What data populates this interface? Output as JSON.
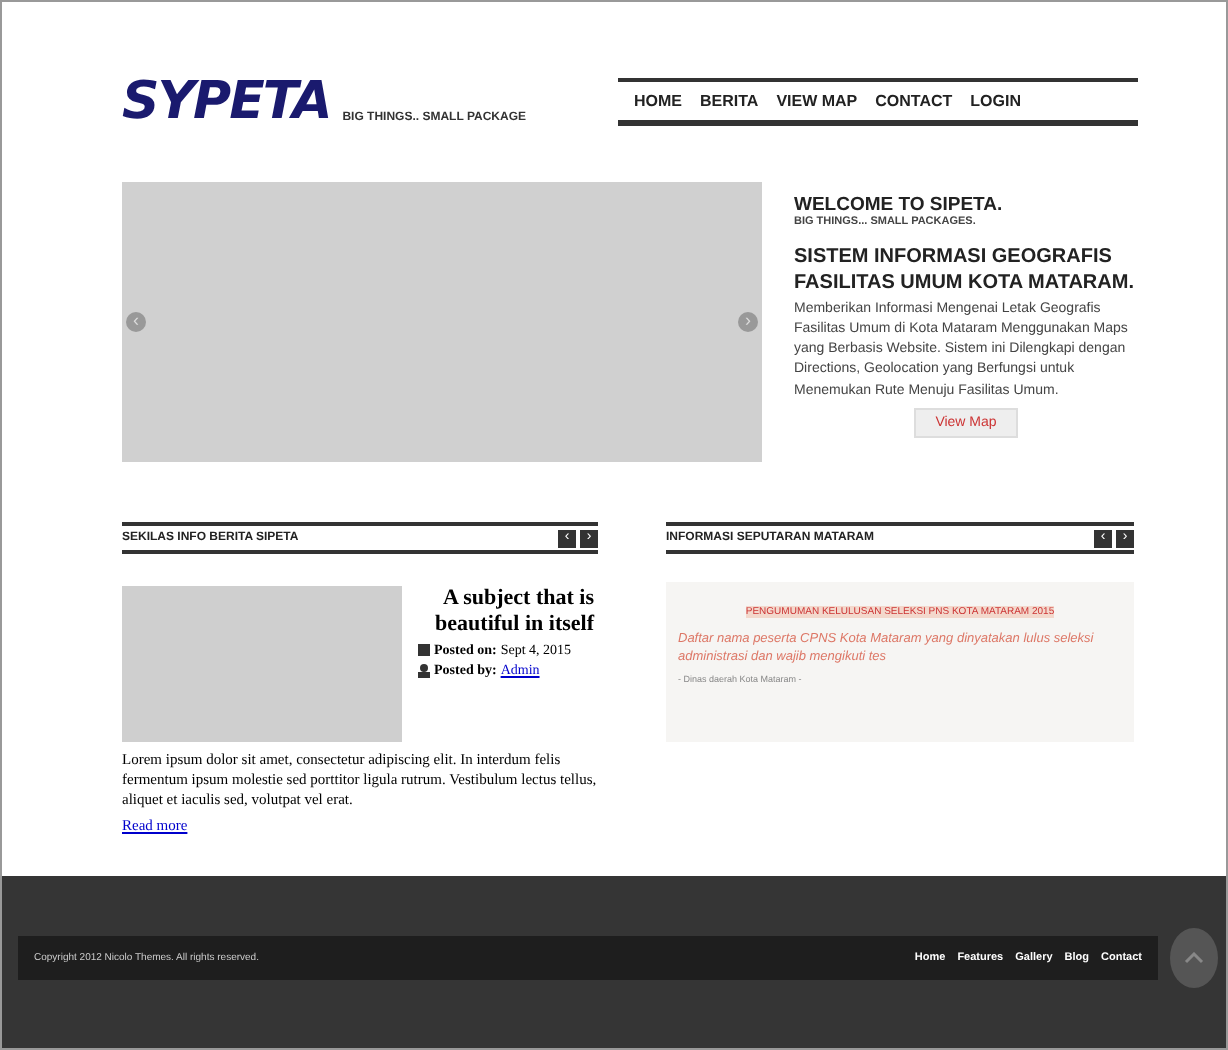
{
  "header": {
    "logo": "SYPETA",
    "tagline": "BIG THINGS.. SMALL PACKAGE"
  },
  "nav": [
    {
      "label": "HOME"
    },
    {
      "label": "BERITA"
    },
    {
      "label": "VIEW MAP"
    },
    {
      "label": "CONTACT"
    },
    {
      "label": "LOGIN"
    }
  ],
  "slider": {
    "prev": "‹",
    "next": "›"
  },
  "welcome": {
    "title": "WELCOME TO SIPETA.",
    "subtitle": "BIG THINGS... SMALL PACKAGES.",
    "heading": "SISTEM INFORMASI GEOGRAFIS FASILITAS UMUM KOTA MATARAM.",
    "description": "Memberikan Informasi Mengenai Letak Geografis Fasilitas Umum di Kota Mataram Menggunakan Maps yang Berbasis Website. Sistem ini Dilengkapi dengan Directions, Geolocation yang Berfungsi untuk Menemukan Rute Menuju Fasilitas Umum.",
    "button": "View Map"
  },
  "news_panel": {
    "title": "SEKILAS INFO BERITA SIPETA",
    "prev": "‹",
    "next": "›",
    "post": {
      "title": "A subject that is beautiful in itself",
      "posted_on_label": "Posted on:",
      "posted_on": "Sept 4, 2015",
      "posted_by_label": "Posted by:",
      "author": "Admin",
      "excerpt": "Lorem ipsum dolor sit amet, consectetur adipiscing elit. In interdum felis fermentum ipsum molestie sed porttitor ligula rutrum. Vestibulum lectus tellus, aliquet et iaculis sed, volutpat vel erat.",
      "read_more": "Read more"
    }
  },
  "info_panel": {
    "title": "INFORMASI SEPUTARAN MATARAM",
    "prev": "‹",
    "next": "›",
    "announcement": {
      "headline": "PENGUMUMAN KELULUSAN SELEKSI PNS KOTA MATARAM 2015",
      "body": "Daftar nama peserta CPNS Kota Mataram yang dinyatakan lulus seleksi administrasi dan wajib mengikuti tes",
      "source": "- Dinas daerah Kota Mataram -"
    }
  },
  "footer": {
    "copyright": "Copyright 2012 Nicolo Themes. All rights reserved.",
    "links": [
      {
        "label": "Home"
      },
      {
        "label": "Features"
      },
      {
        "label": "Gallery"
      },
      {
        "label": "Blog"
      },
      {
        "label": "Contact"
      }
    ]
  }
}
